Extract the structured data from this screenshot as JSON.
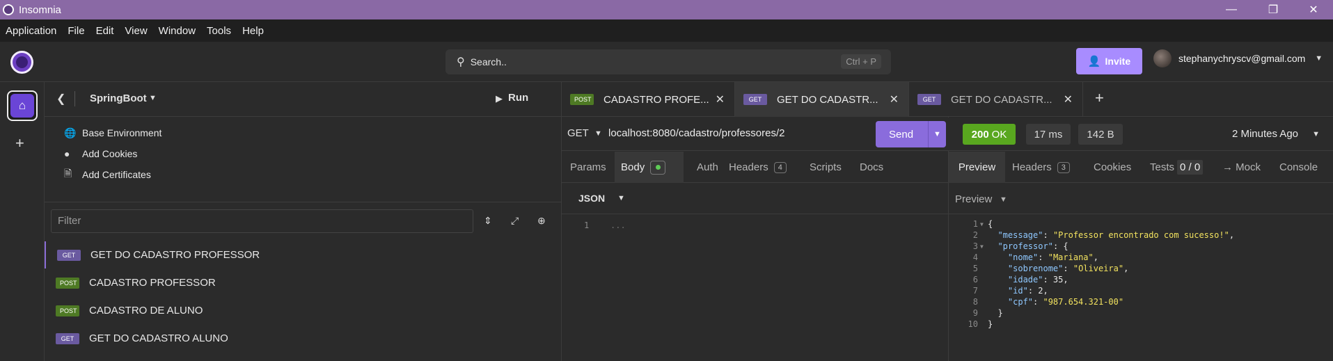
{
  "window": {
    "title": "Insomnia",
    "controls": [
      "minimize",
      "restore",
      "close"
    ]
  },
  "menu": [
    "Application",
    "File",
    "Edit",
    "View",
    "Window",
    "Tools",
    "Help"
  ],
  "topbar": {
    "search_placeholder": "Search..",
    "search_shortcut": "Ctrl + P",
    "invite_label": "Invite",
    "user_email": "stephanychryscv@gmail.com"
  },
  "sidebar": {
    "project": "SpringBoot",
    "run_label": "Run",
    "env_items": [
      "Base Environment",
      "Add Cookies",
      "Add Certificates"
    ],
    "filter_placeholder": "Filter",
    "requests": [
      {
        "method": "GET",
        "name": "GET DO CADASTRO PROFESSOR",
        "active": true
      },
      {
        "method": "POST",
        "name": "CADASTRO PROFESSOR"
      },
      {
        "method": "POST",
        "name": "CADASTRO DE ALUNO"
      },
      {
        "method": "GET",
        "name": "GET DO CADASTRO ALUNO"
      }
    ]
  },
  "tabs": [
    {
      "method": "POST",
      "label": "CADASTRO PROFE..."
    },
    {
      "method": "GET",
      "label": "GET DO CADASTR...",
      "selected": true
    },
    {
      "method": "GET",
      "label": "GET DO CADASTR..."
    }
  ],
  "request": {
    "method": "GET",
    "url": "localhost:8080/cadastro/professores/2",
    "send_label": "Send",
    "subtabs": {
      "params": "Params",
      "body": "Body",
      "auth": "Auth",
      "headers": "Headers",
      "headers_count": "4",
      "scripts": "Scripts",
      "docs": "Docs"
    },
    "body_format": "JSON",
    "editor_line": "1",
    "editor_placeholder": "..."
  },
  "response": {
    "status_code": "200",
    "status_text": "OK",
    "time": "17 ms",
    "size": "142 B",
    "ago": "2 Minutes Ago",
    "tabs": {
      "preview": "Preview",
      "headers": "Headers",
      "headers_count": "3",
      "cookies": "Cookies",
      "tests": "Tests",
      "tests_count": "0 / 0",
      "mock": "→ Mock",
      "console": "Console"
    },
    "preview_mode": "Preview",
    "lines": [
      {
        "n": "1",
        "fold": true,
        "parts": [
          [
            "v",
            "{"
          ]
        ]
      },
      {
        "n": "2",
        "parts": [
          [
            "v",
            "  "
          ],
          [
            "k",
            "\"message\""
          ],
          [
            "v",
            ": "
          ],
          [
            "s",
            "\"Professor encontrado com sucesso!\""
          ],
          [
            "v",
            ","
          ]
        ]
      },
      {
        "n": "3",
        "fold": true,
        "parts": [
          [
            "v",
            "  "
          ],
          [
            "k",
            "\"professor\""
          ],
          [
            "v",
            ": {"
          ]
        ]
      },
      {
        "n": "4",
        "parts": [
          [
            "v",
            "    "
          ],
          [
            "k",
            "\"nome\""
          ],
          [
            "v",
            ": "
          ],
          [
            "s",
            "\"Mariana\""
          ],
          [
            "v",
            ","
          ]
        ]
      },
      {
        "n": "5",
        "parts": [
          [
            "v",
            "    "
          ],
          [
            "k",
            "\"sobrenome\""
          ],
          [
            "v",
            ": "
          ],
          [
            "s",
            "\"Oliveira\""
          ],
          [
            "v",
            ","
          ]
        ]
      },
      {
        "n": "6",
        "parts": [
          [
            "v",
            "    "
          ],
          [
            "k",
            "\"idade\""
          ],
          [
            "v",
            ": 35,"
          ]
        ]
      },
      {
        "n": "7",
        "parts": [
          [
            "v",
            "    "
          ],
          [
            "k",
            "\"id\""
          ],
          [
            "v",
            ": 2,"
          ]
        ]
      },
      {
        "n": "8",
        "parts": [
          [
            "v",
            "    "
          ],
          [
            "k",
            "\"cpf\""
          ],
          [
            "v",
            ": "
          ],
          [
            "s",
            "\"987.654.321-00\""
          ]
        ]
      },
      {
        "n": "9",
        "parts": [
          [
            "v",
            "  }"
          ]
        ]
      },
      {
        "n": "10",
        "parts": [
          [
            "v",
            "}"
          ]
        ]
      }
    ]
  },
  "colors": {
    "accent": "#8a6cdc",
    "title_bar": "#8a69a5",
    "status_ok": "#59a71f",
    "get_badge": "#6a5aa0",
    "post_badge": "#4e7a24"
  }
}
